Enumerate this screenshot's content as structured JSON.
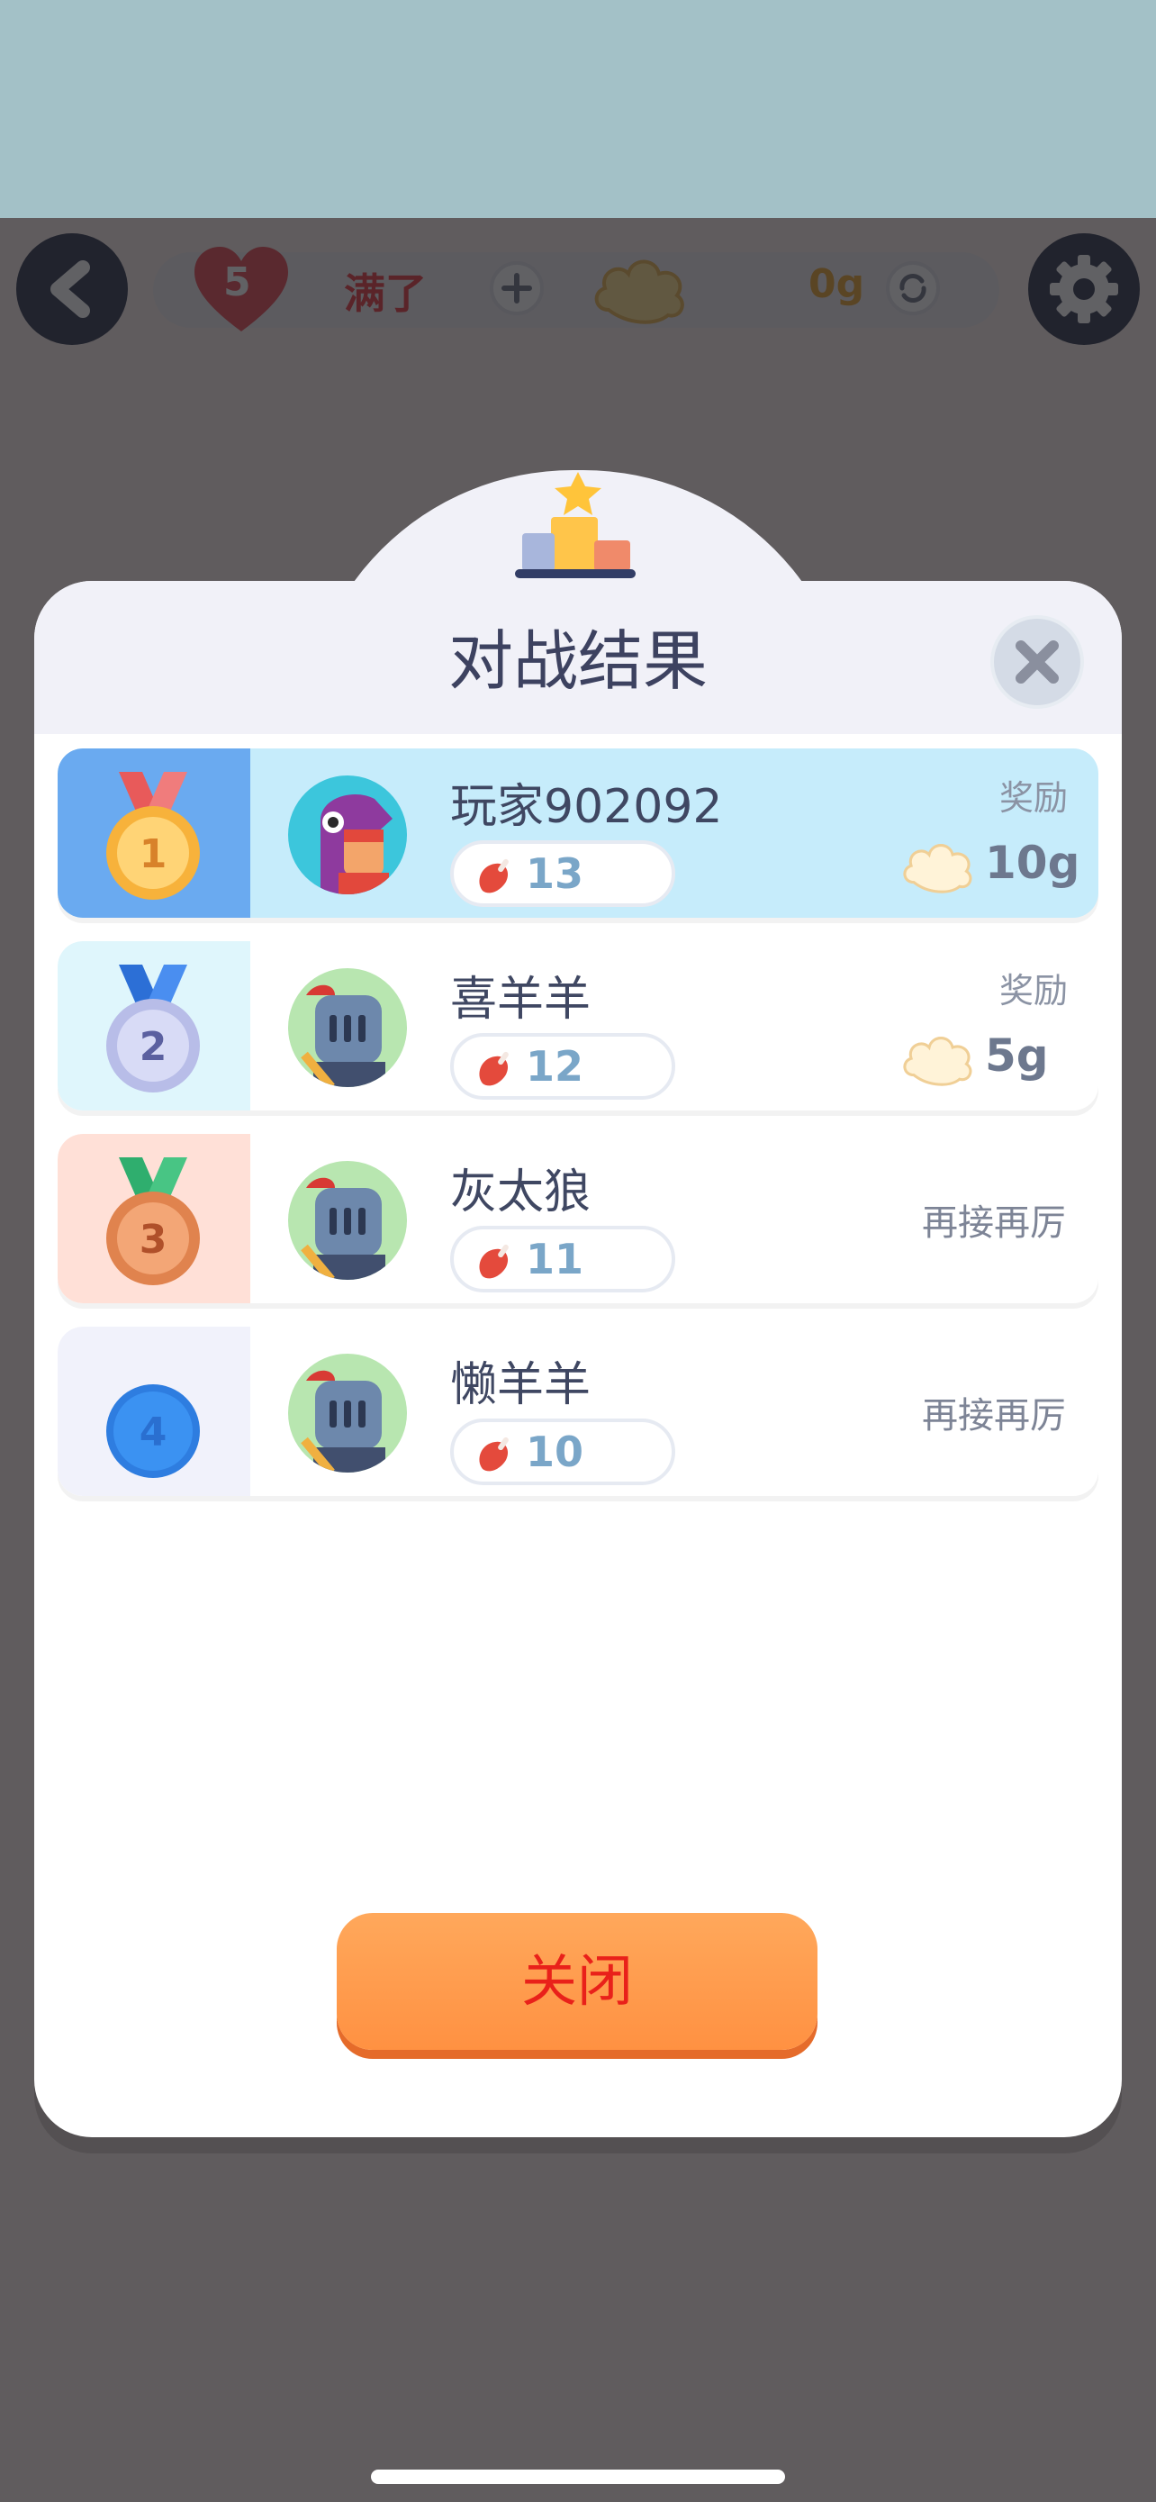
{
  "hud": {
    "lives": "5",
    "lives_status": "满了",
    "currency": "0g"
  },
  "modal": {
    "title": "对战结果",
    "close_button": "关闭"
  },
  "results": [
    {
      "rank": "1",
      "name": "玩家902092",
      "score": "13",
      "reward_label": "奖励",
      "reward": "10g",
      "avatar": "dragon-avatar"
    },
    {
      "rank": "2",
      "name": "喜羊羊",
      "score": "12",
      "reward_label": "奖励",
      "reward": "5g",
      "avatar": "knight-avatar"
    },
    {
      "rank": "3",
      "name": "灰太狼",
      "score": "11",
      "message": "再接再厉",
      "avatar": "knight-avatar"
    },
    {
      "rank": "4",
      "name": "懒羊羊",
      "score": "10",
      "message": "再接再厉",
      "avatar": "knight-avatar"
    }
  ],
  "colors": {
    "rank1_panel": "#6aaaf0",
    "rank1_row": "#c6ecfb",
    "rank2_panel": "#dff6fc",
    "rank3_panel": "#ffe0d7",
    "rank4_panel": "#f1f2fb",
    "close_button": "#ff9a4a",
    "close_text": "#e9211a"
  }
}
